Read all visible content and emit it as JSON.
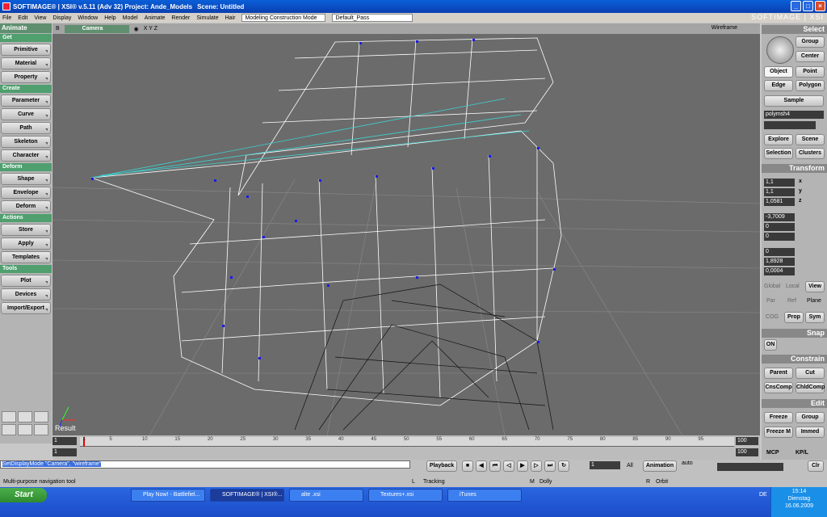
{
  "window": {
    "title": "SOFTIMAGE® | XSI® v.5.11 (Adv 32) Project: Ande_Models",
    "scene": "Scene: Untitled"
  },
  "menu": {
    "items": [
      "File",
      "Edit",
      "View",
      "Display",
      "Window",
      "Help",
      "Model",
      "Animate",
      "Render",
      "Simulate",
      "Hair"
    ],
    "layout_dropdown": "Modeling Construction Mode",
    "pass_dropdown": "Default_Pass"
  },
  "logo": "SOFTIMAGE | XSI",
  "left": {
    "mode": "Animate",
    "sections": [
      {
        "title": "Get",
        "buttons": [
          "Primitive",
          "Material",
          "Property"
        ]
      },
      {
        "title": "Create",
        "buttons": [
          "Parameter",
          "Curve",
          "Path",
          "Skeleton",
          "Character"
        ]
      },
      {
        "title": "Deform",
        "buttons": [
          "Shape",
          "Envelope",
          "Deform"
        ]
      },
      {
        "title": "Actions",
        "buttons": [
          "Store",
          "Apply",
          "Templates"
        ]
      },
      {
        "title": "Tools",
        "buttons": [
          "Plot",
          "Devices",
          "Import/Export"
        ]
      }
    ]
  },
  "viewport": {
    "camera": "Camera",
    "axes": "X Y Z",
    "mode": "Wireframe",
    "label": "Result"
  },
  "right": {
    "select_title": "Select",
    "group": "Group",
    "center": "Center",
    "object": "Object",
    "point": "Point",
    "edge": "Edge",
    "polygon": "Polygon",
    "sample": "Sample",
    "object_name": "polymsh4",
    "explore": "Explore",
    "scene": "Scene",
    "selection": "Selection",
    "clusters": "Clusters",
    "transform_title": "Transform",
    "scale": {
      "x": "1,1",
      "y": "1,1",
      "z": "1,0581"
    },
    "rotate": {
      "x": "-3,7009",
      "y": "0",
      "z": "0"
    },
    "translate": {
      "x": "0",
      "y": "1,8928",
      "z": "0,0004"
    },
    "global": "Global",
    "local": "Local",
    "view": "View",
    "par": "Par",
    "ref": "Ref",
    "plane": "Plane",
    "cog": "COG",
    "prop": "Prop",
    "sym": "Sym",
    "snap_title": "Snap",
    "snap_on": "ON",
    "constrain_title": "Constrain",
    "parent": "Parent",
    "cut": "Cut",
    "cnscomp": "CnsComp",
    "childcomp": "ChldComp",
    "edit_title": "Edit",
    "freeze": "Freeze",
    "group2": "Group",
    "freezem": "Freeze M",
    "immed": "Immed",
    "mcp": "MCP",
    "kpl": "KP/L"
  },
  "timeline": {
    "start": "1",
    "start2": "1",
    "end": "100",
    "end2": "100",
    "ticks": [
      "1",
      "5",
      "10",
      "15",
      "20",
      "25",
      "30",
      "35",
      "40",
      "45",
      "50",
      "55",
      "60",
      "65",
      "70",
      "75",
      "80",
      "85",
      "90",
      "95"
    ],
    "frame": "1",
    "all": "All"
  },
  "playback": {
    "playback": "Playback",
    "animation": "Animation",
    "auto": "auto",
    "clr": "Clr"
  },
  "command": {
    "text": "SetDisplayMode \"Camera\", \"wireframe\""
  },
  "status": {
    "tool": "Multi-purpose navigation tool",
    "l": "L",
    "tracking": "Tracking",
    "m": "M",
    "dolly": "Dolly",
    "r": "R",
    "orbit": "Orbit"
  },
  "taskbar": {
    "start": "Start",
    "tasks": [
      "Play Now! - Battlefiel...",
      "SOFTIMAGE® | XSI®...",
      "alte .xsi",
      "Textures+.xsi",
      "iTunes"
    ],
    "lang": "DE",
    "time": "15:14",
    "day": "Dienstag",
    "date": "16.06.2009"
  }
}
